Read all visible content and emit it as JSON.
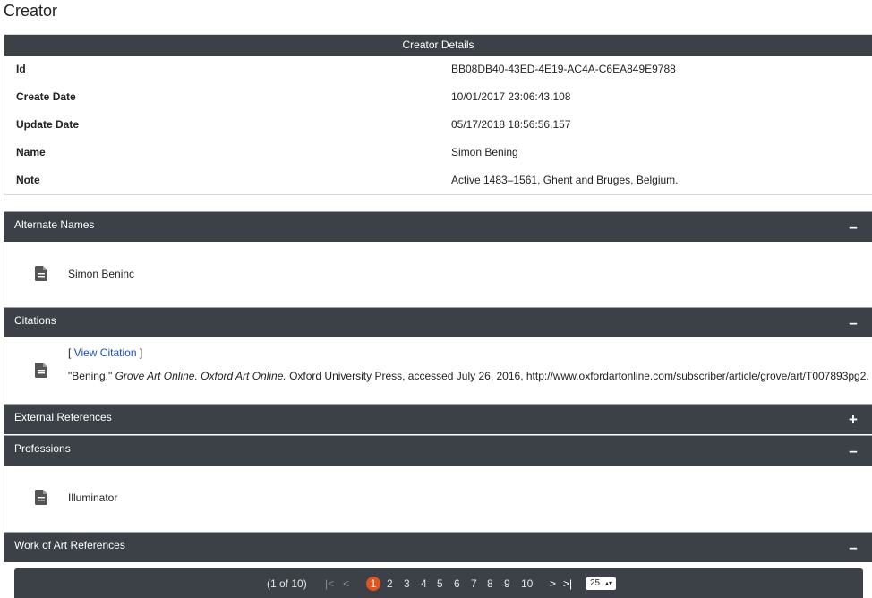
{
  "page_title": "Creator",
  "details": {
    "header": "Creator Details",
    "rows": [
      {
        "label": "Id",
        "value": "BB08DB40-43ED-4E19-AC4A-C6EA849E9788"
      },
      {
        "label": "Create Date",
        "value": "10/01/2017 23:06:43.108"
      },
      {
        "label": "Update Date",
        "value": "05/17/2018 18:56:56.157"
      },
      {
        "label": "Name",
        "value": "Simon Bening"
      },
      {
        "label": "Note",
        "value": "Active 1483–1561, Ghent and Bruges, Belgium."
      }
    ]
  },
  "panels": {
    "alternate_names": {
      "title": "Alternate Names",
      "toggle": "–",
      "items": [
        "Simon Beninc"
      ]
    },
    "citations": {
      "title": "Citations",
      "toggle": "–",
      "link_open": "[ ",
      "link_text": "View Citation",
      "link_close": " ]",
      "quote": "\"Bening.\" ",
      "italic": "Grove Art Online. Oxford Art Online.",
      "rest": " Oxford University Press, accessed July 26, 2016, http://www.oxfordartonline.com/subscriber/article/grove/art/T007893pg2."
    },
    "external_references": {
      "title": "External References",
      "toggle": "+"
    },
    "professions": {
      "title": "Professions",
      "toggle": "–",
      "items": [
        "Illuminator"
      ]
    },
    "work_of_art_references": {
      "title": "Work of Art References",
      "toggle": "–"
    }
  },
  "paginator": {
    "summary": "(1 of 10)",
    "first": "|<",
    "prev": "<",
    "pages": [
      "1",
      "2",
      "3",
      "4",
      "5",
      "6",
      "7",
      "8",
      "9",
      "10"
    ],
    "current_page": "1",
    "next": ">",
    "last": ">|",
    "rows_per_page": "25",
    "rows_arrows": "▴▾"
  }
}
